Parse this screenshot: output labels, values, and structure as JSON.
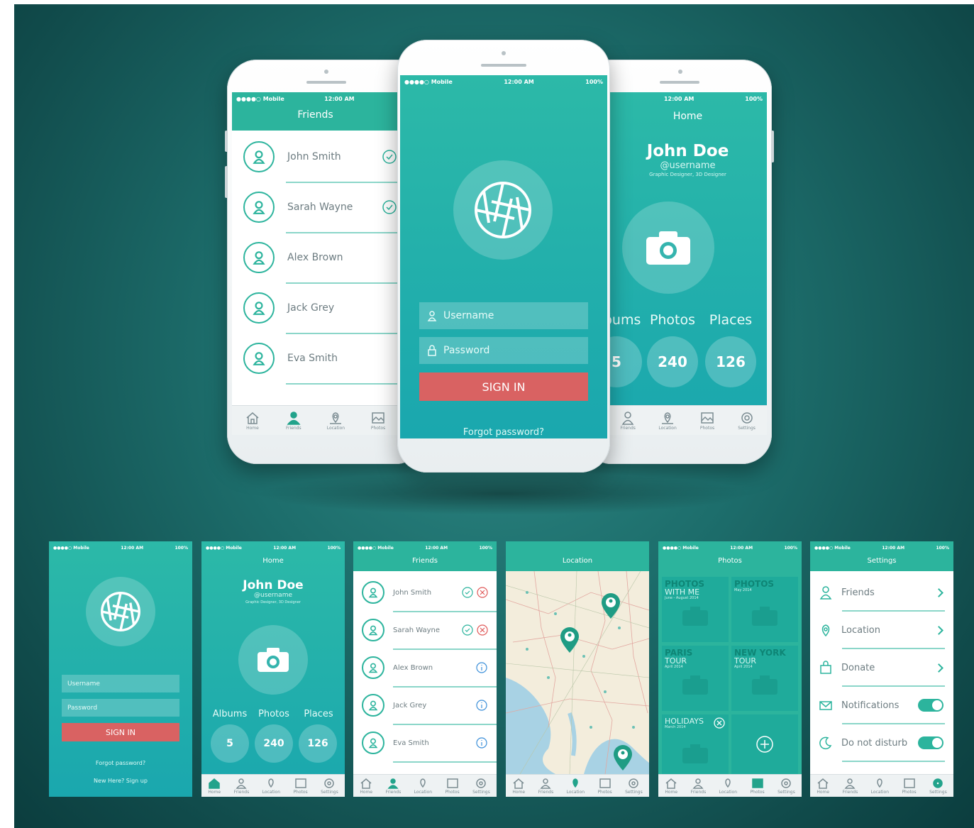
{
  "status": {
    "carrier": "●●●●○ Mobile",
    "time": "12:00 AM",
    "battery": "100%"
  },
  "friends": {
    "title": "Friends",
    "names": [
      "John Smith",
      "Sarah Wayne",
      "Alex Brown",
      "Jack Grey",
      "Eva Smith"
    ]
  },
  "login": {
    "username": "Username",
    "password": "Password",
    "signin": "SIGN IN",
    "forgot": "Forgot password?",
    "signup": "New Here? Sign up"
  },
  "home": {
    "title": "Home",
    "name": "John Doe",
    "handle": "@username",
    "role": "Graphic Designer, 3D Designer",
    "stats": [
      {
        "label": "Albums",
        "value": "5"
      },
      {
        "label": "Photos",
        "value": "240"
      },
      {
        "label": "Places",
        "value": "126"
      }
    ]
  },
  "location": {
    "title": "Location"
  },
  "photos": {
    "title": "Photos",
    "tiles": [
      {
        "t1": "PHOTOS",
        "t2": "WITH ME",
        "t3": "June - August 2014"
      },
      {
        "t1": "PHOTOS",
        "t2": "",
        "t3": "May 2014"
      },
      {
        "t1": "PARIS",
        "t2": "TOUR",
        "t3": "April 2014"
      },
      {
        "t1": "NEW YORK",
        "t2": "TOUR",
        "t3": "April 2014"
      },
      {
        "t1": "",
        "t2": "HOLIDAYS",
        "t3": "March 2014"
      }
    ]
  },
  "settings": {
    "title": "Settings",
    "items": [
      "Friends",
      "Location",
      "Donate",
      "Notifications",
      "Do not disturb"
    ]
  },
  "nav": {
    "home": "Home",
    "friends": "Friends",
    "location": "Location",
    "photos": "Photos",
    "settings": "Settings"
  },
  "colors": {
    "teal": "#2cb49d",
    "signin": "#d96262",
    "bg": "#1d6e6c"
  }
}
